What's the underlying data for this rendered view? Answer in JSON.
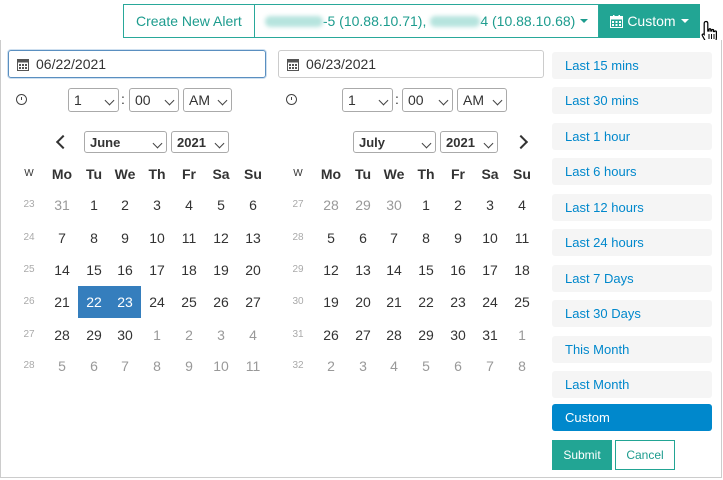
{
  "toolbar": {
    "create_alert_label": "Create New Alert",
    "hosts_label_a": "-5 (10.88.10.71),",
    "hosts_label_b": "4 (10.88.10.68)",
    "custom_label": "Custom"
  },
  "left": {
    "date": "06/22/2021",
    "hour": "1",
    "minute": "00",
    "ampm": "AM",
    "month": "June",
    "year": "2021",
    "headers": [
      "W",
      "Mo",
      "Tu",
      "We",
      "Th",
      "Fr",
      "Sa",
      "Su"
    ],
    "weeks": [
      [
        "23",
        "31",
        "1",
        "2",
        "3",
        "4",
        "5",
        "6"
      ],
      [
        "24",
        "7",
        "8",
        "9",
        "10",
        "11",
        "12",
        "13"
      ],
      [
        "25",
        "14",
        "15",
        "16",
        "17",
        "18",
        "19",
        "20"
      ],
      [
        "26",
        "21",
        "22",
        "23",
        "24",
        "25",
        "26",
        "27"
      ],
      [
        "27",
        "28",
        "29",
        "30",
        "1",
        "2",
        "3",
        "4"
      ],
      [
        "28",
        "5",
        "6",
        "7",
        "8",
        "9",
        "10",
        "11"
      ]
    ]
  },
  "right": {
    "date": "06/23/2021",
    "hour": "1",
    "minute": "00",
    "ampm": "AM",
    "month": "July",
    "year": "2021",
    "headers": [
      "W",
      "Mo",
      "Tu",
      "We",
      "Th",
      "Fr",
      "Sa",
      "Su"
    ],
    "weeks": [
      [
        "27",
        "28",
        "29",
        "30",
        "1",
        "2",
        "3",
        "4"
      ],
      [
        "28",
        "5",
        "6",
        "7",
        "8",
        "9",
        "10",
        "11"
      ],
      [
        "29",
        "12",
        "13",
        "14",
        "15",
        "16",
        "17",
        "18"
      ],
      [
        "30",
        "19",
        "20",
        "21",
        "22",
        "23",
        "24",
        "25"
      ],
      [
        "31",
        "26",
        "27",
        "28",
        "29",
        "30",
        "31",
        "1"
      ],
      [
        "32",
        "2",
        "3",
        "4",
        "5",
        "6",
        "7",
        "8"
      ]
    ]
  },
  "ranges": [
    "Last 15 mins",
    "Last 30 mins",
    "Last 1 hour",
    "Last 6 hours",
    "Last 12 hours",
    "Last 24 hours",
    "Last 7 Days",
    "Last 30 Days",
    "This Month",
    "Last Month",
    "Custom"
  ],
  "active_range": "Custom",
  "buttons": {
    "submit": "Submit",
    "cancel": "Cancel"
  },
  "colors": {
    "accent": "#22a594",
    "selected_day": "#357ebd",
    "range_text": "#0088cc"
  },
  "icons": [
    "calendar-icon",
    "clock-icon",
    "chevron-left-icon",
    "chevron-right-icon",
    "caret-down-icon",
    "hand-cursor-icon"
  ]
}
